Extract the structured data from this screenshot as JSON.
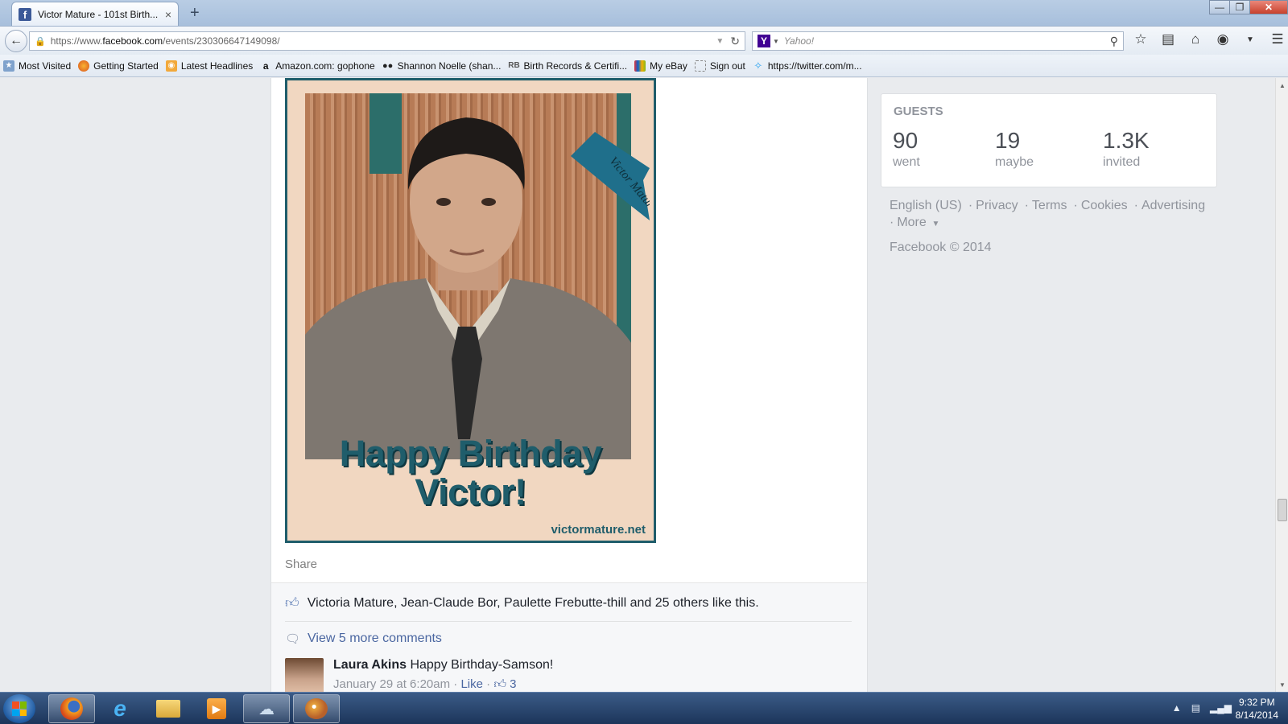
{
  "browser": {
    "tab_title": "Victor Mature - 101st Birth...",
    "tab_close": "×",
    "new_tab": "+",
    "url_prefix": "https://www.",
    "url_domain": "facebook.com",
    "url_path": "/events/230306647149098/",
    "search_placeholder": "Yahoo!",
    "search_engine_letter": "Y"
  },
  "bookmarks": [
    {
      "label": "Most Visited",
      "icon": "bookmark-folder-icon"
    },
    {
      "label": "Getting Started",
      "icon": "firefox-icon"
    },
    {
      "label": "Latest Headlines",
      "icon": "rss-icon"
    },
    {
      "label": "Amazon.com: gophone",
      "icon": "amazon-icon"
    },
    {
      "label": "Shannon Noelle (shan...",
      "icon": "people-icon"
    },
    {
      "label": "Birth Records & Certifi...",
      "icon": "rb-icon"
    },
    {
      "label": "My eBay",
      "icon": "ebay-icon"
    },
    {
      "label": "Sign out",
      "icon": "page-icon"
    },
    {
      "label": "https://twitter.com/m...",
      "icon": "twitter-icon"
    }
  ],
  "post": {
    "photo_title_line1": "Happy Birthday",
    "photo_title_line2": "Victor!",
    "photo_site": "victormature.net",
    "ribbon_text": "Victor Mature",
    "share": "Share",
    "likes_text": "Victoria Mature, Jean-Claude Bor, Paulette Frebutte-thill and 25 others like this.",
    "view_more": "View 5 more comments",
    "comment": {
      "author": "Laura Akins",
      "text": "Happy Birthday-Samson!",
      "time": "January 29 at 6:20am",
      "like": "Like",
      "like_count": "3"
    }
  },
  "guests": {
    "header": "GUESTS",
    "stats": [
      {
        "num": "90",
        "label": "went"
      },
      {
        "num": "19",
        "label": "maybe"
      },
      {
        "num": "1.3K",
        "label": "invited"
      }
    ]
  },
  "footer": {
    "links": [
      "English (US)",
      "Privacy",
      "Terms",
      "Cookies",
      "Advertising"
    ],
    "more": "More",
    "copyright": "Facebook © 2014"
  },
  "taskbar": {
    "time": "9:32 PM",
    "date": "8/14/2014"
  }
}
